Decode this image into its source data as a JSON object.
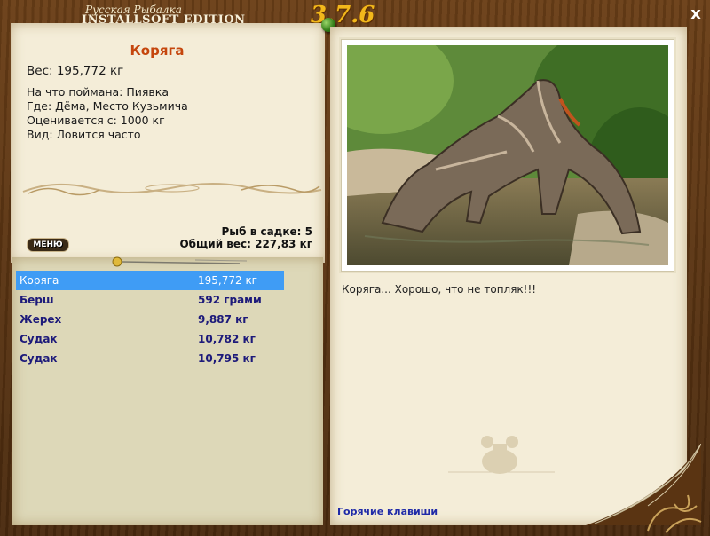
{
  "window": {
    "title_small": "Русская Рыбалка",
    "title_big": "INSTALLSOFT EDITION",
    "version": "3.7.6",
    "close_glyph": "x"
  },
  "fish_card": {
    "name": "Коряга",
    "weight_line": "Вес: 195,772 кг",
    "caught_on": "На что поймана: Пиявка",
    "location": "Где: Дёма, Место Кузьмича",
    "value": "Оценивается с: 1000 кг",
    "kind": "Вид: Ловится часто"
  },
  "keepnet": {
    "count_line": "Рыб в садке: 5",
    "total_line": "Общий вес: 227,83 кг"
  },
  "menu": {
    "label": "МЕНЮ"
  },
  "catch_list": [
    {
      "name": "Коряга",
      "weight": "195,772 кг",
      "selected": true
    },
    {
      "name": "Берш",
      "weight": "592 грамм",
      "selected": false
    },
    {
      "name": "Жерех",
      "weight": "9,887 кг",
      "selected": false
    },
    {
      "name": "Судак",
      "weight": "10,782 кг",
      "selected": false
    },
    {
      "name": "Судак",
      "weight": "10,795 кг",
      "selected": false
    }
  ],
  "photo": {
    "caption": "Коряга... Хорошо, что не топляк!!!"
  },
  "footer": {
    "hotkeys_label": "Горячие клавиши"
  },
  "colors": {
    "accent_name": "#c5460d",
    "list_text": "#1d1a7a",
    "selected_row": "#3f9cf5",
    "link": "#1f2aa8",
    "version": "#f2b81b"
  },
  "icons": [
    "close-icon",
    "green-pin-icon",
    "brass-pin-icon",
    "ornament-divider-icon",
    "mascot-silhouette-icon",
    "page-curl-icon"
  ]
}
